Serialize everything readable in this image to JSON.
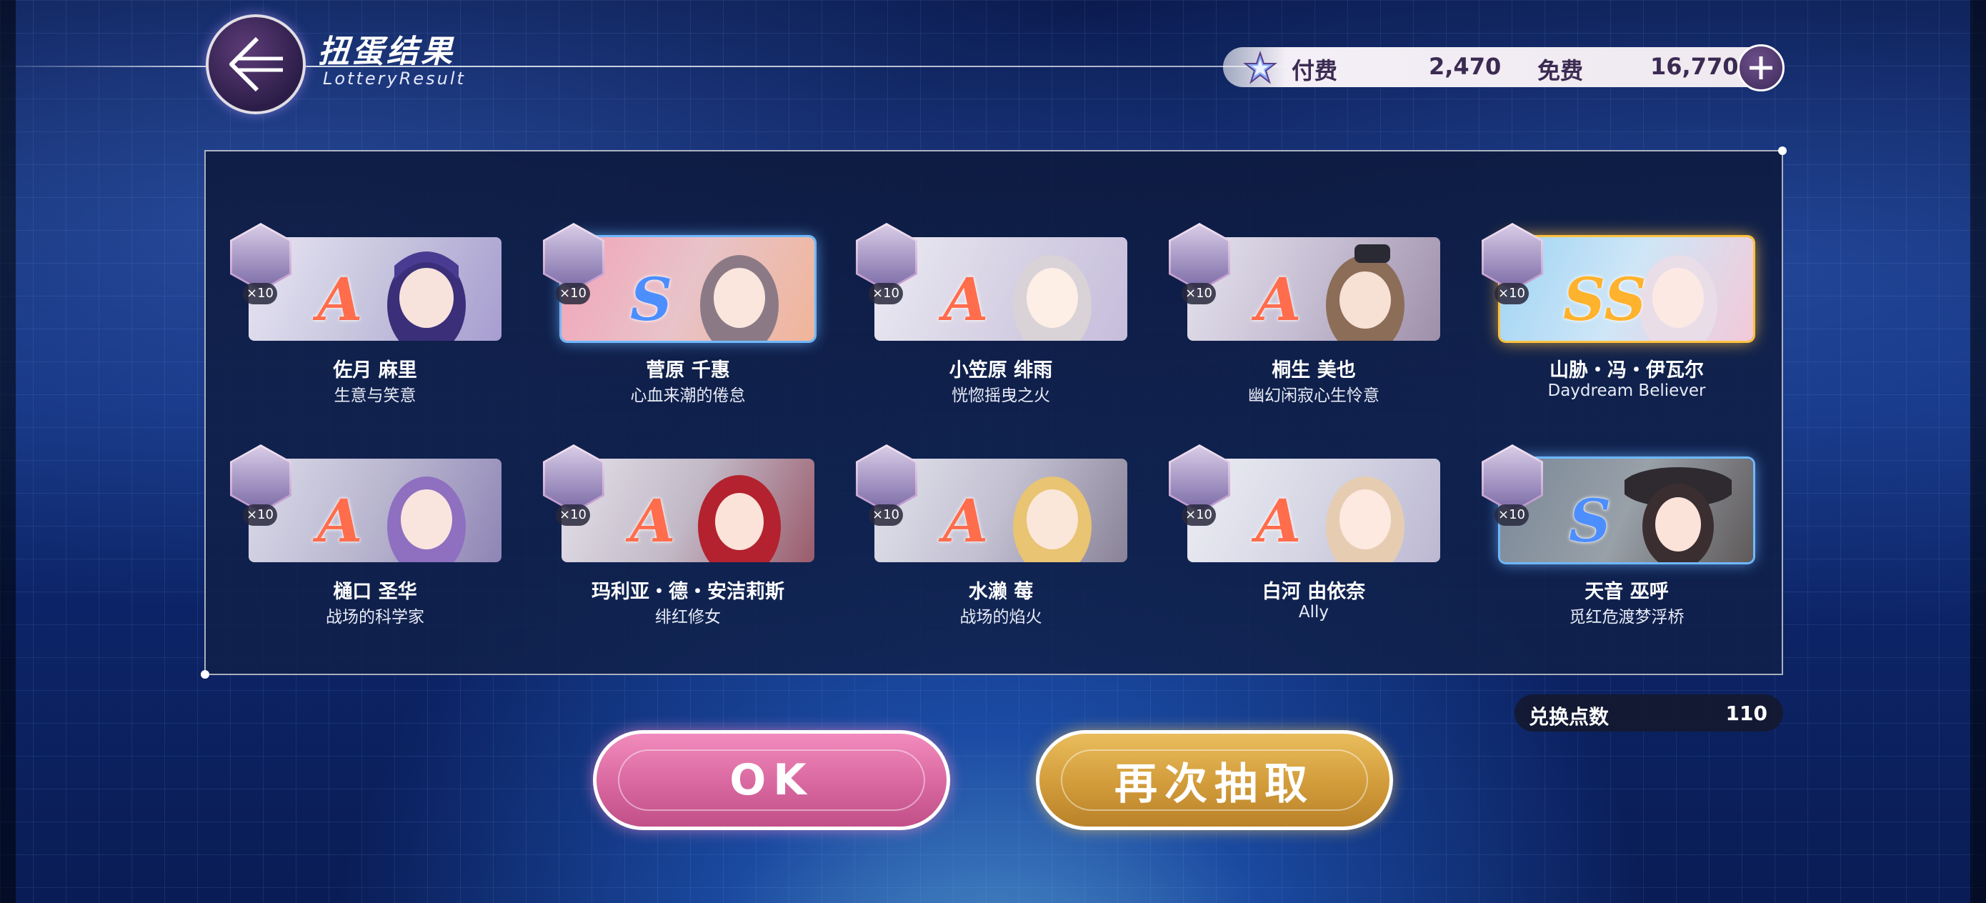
{
  "header": {
    "title": "扭蛋结果",
    "subtitle": "LotteryResult",
    "back_icon": "back-arrow-icon"
  },
  "currency": {
    "paid_label": "付费",
    "paid_value": "2,470",
    "free_label": "免费",
    "free_value": "16,770",
    "gem_icon": "star-gem-icon",
    "add_icon": "plus-icon"
  },
  "results": [
    {
      "rank": "A",
      "count": "×10",
      "name": "佐月 麻里",
      "subtitle": "生意与笑意"
    },
    {
      "rank": "S",
      "count": "×10",
      "name": "菅原 千惠",
      "subtitle": "心血来潮的倦怠"
    },
    {
      "rank": "A",
      "count": "×10",
      "name": "小笠原 绯雨",
      "subtitle": "恍惚摇曳之火"
    },
    {
      "rank": "A",
      "count": "×10",
      "name": "桐生 美也",
      "subtitle": "幽幻闲寂心生怜意"
    },
    {
      "rank": "SS",
      "count": "×10",
      "name": "山胁・冯・伊瓦尔",
      "subtitle": "Daydream Believer"
    },
    {
      "rank": "A",
      "count": "×10",
      "name": "樋口 圣华",
      "subtitle": "战场的科学家"
    },
    {
      "rank": "A",
      "count": "×10",
      "name": "玛利亚・德・安洁莉斯",
      "subtitle": "绯红修女"
    },
    {
      "rank": "A",
      "count": "×10",
      "name": "水濑 莓",
      "subtitle": "战场的焰火"
    },
    {
      "rank": "A",
      "count": "×10",
      "name": "白河 由依奈",
      "subtitle": "Ally"
    },
    {
      "rank": "S",
      "count": "×10",
      "name": "天音 巫呼",
      "subtitle": "觅红危渡梦浮桥"
    }
  ],
  "exchange": {
    "label": "兑换点数",
    "value": "110"
  },
  "buttons": {
    "ok": "OK",
    "draw_again": "再次抽取"
  },
  "colors": {
    "rank_a": "#ff6d4d",
    "rank_s": "#4d8eff",
    "rank_ss": "#ffb22e",
    "ok_button": "#d8679f",
    "again_button": "#d29b3a"
  }
}
